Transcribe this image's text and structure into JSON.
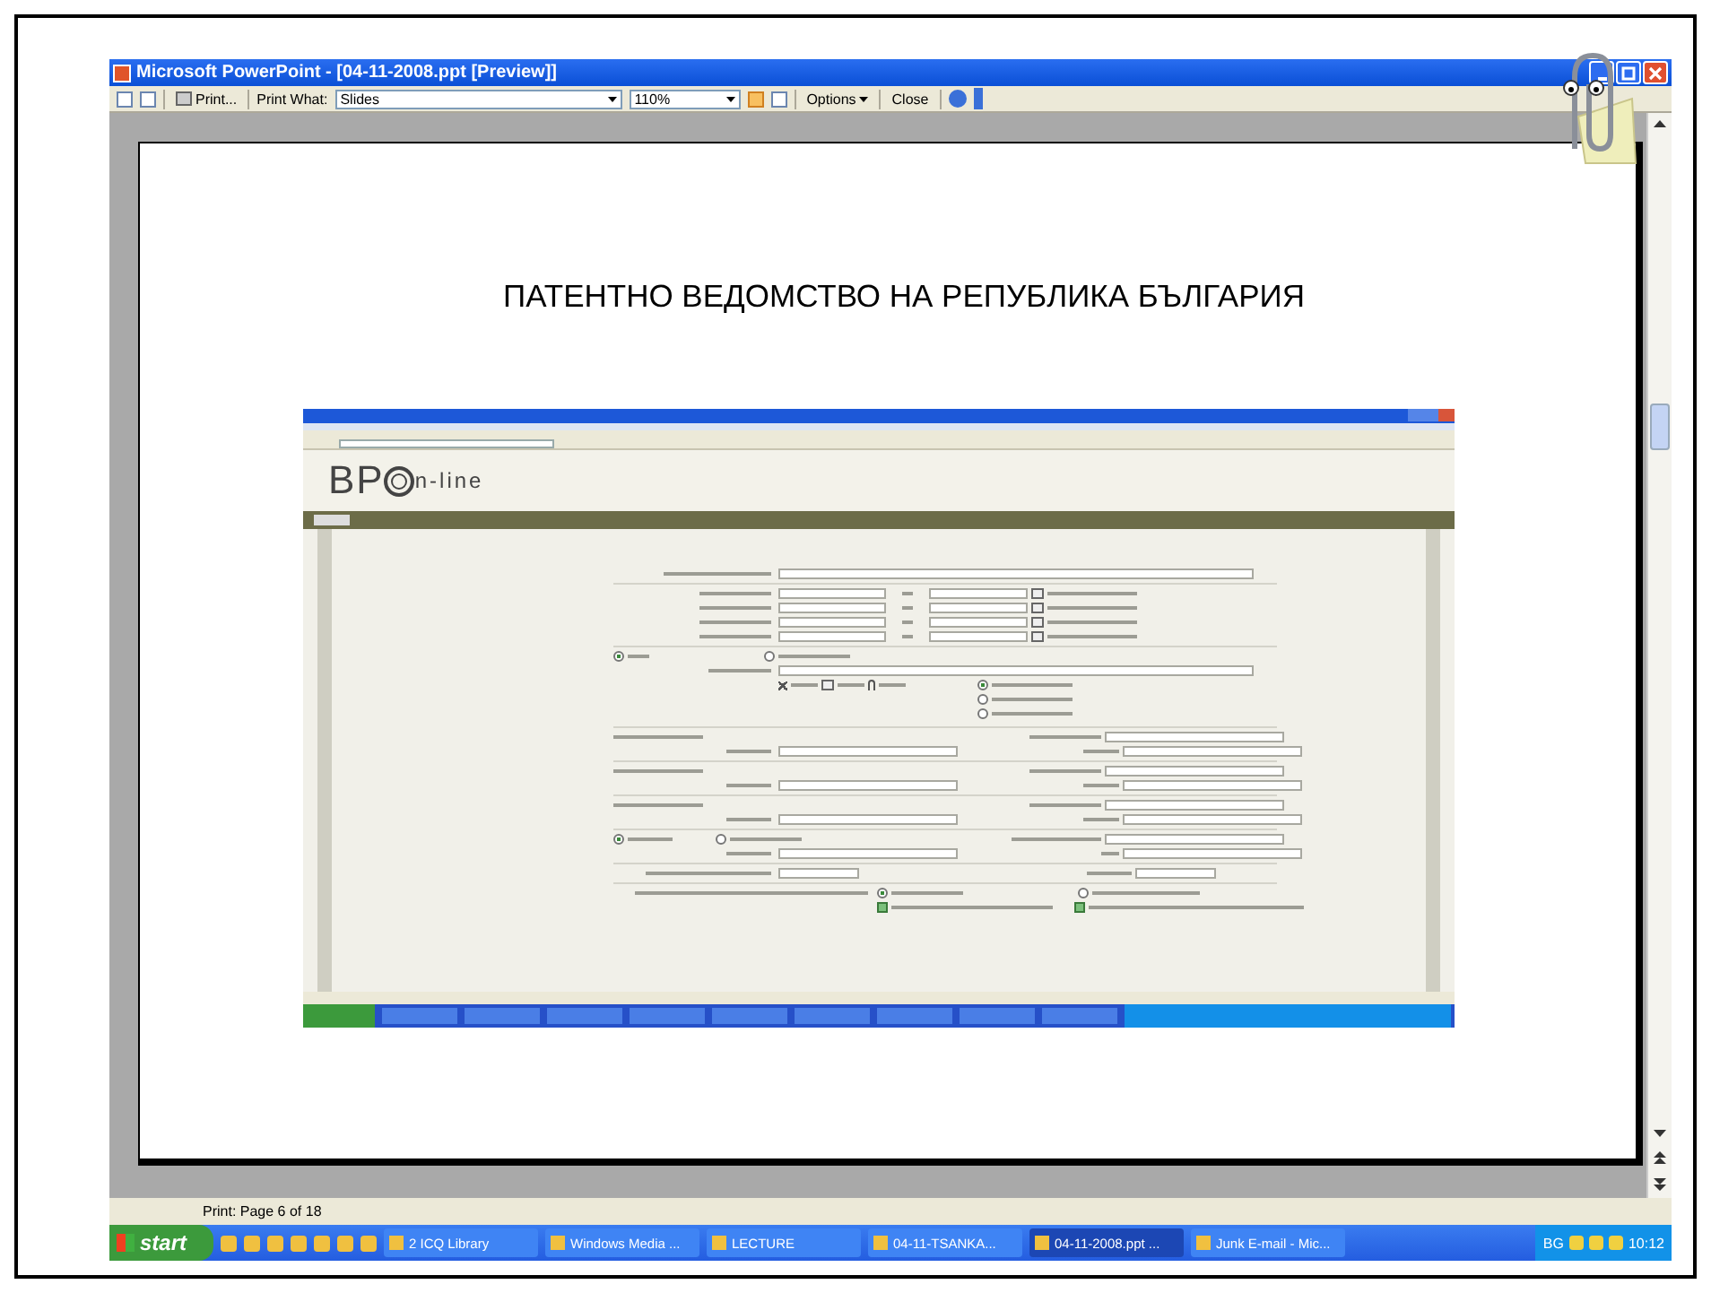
{
  "window": {
    "title": "Microsoft PowerPoint - [04-11-2008.ppt [Preview]]"
  },
  "toolbar": {
    "print": "Print...",
    "print_what_label": "Print What:",
    "print_what_value": "Slides",
    "zoom": "110%",
    "options": "Options",
    "close": "Close"
  },
  "slide": {
    "title": "ПАТЕНТНО ВЕДОМСТВО НА РЕПУБЛИКА БЪЛГАРИЯ",
    "screenshot": {
      "logo_main": "BP",
      "logo_rest": "n-line",
      "radios": [
        {
          "selected": true
        },
        {
          "selected": false
        },
        {
          "selected": true
        },
        {
          "selected": false
        },
        {
          "selected": false
        },
        {
          "selected": true
        },
        {
          "selected": false
        },
        {
          "selected": true
        },
        {
          "selected": false
        }
      ],
      "checkboxes": [
        {
          "checked": true
        },
        {
          "checked": true
        }
      ]
    }
  },
  "status_bar": "Print: Page 6 of 18",
  "taskbar": {
    "start": "start",
    "items": [
      {
        "label": "2 ICQ Library",
        "selected": false
      },
      {
        "label": "Windows Media ...",
        "selected": false
      },
      {
        "label": "LECTURE",
        "selected": false
      },
      {
        "label": "04-11-TSANKA...",
        "selected": false
      },
      {
        "label": "04-11-2008.ppt ...",
        "selected": true
      },
      {
        "label": "Junk E-mail - Mic...",
        "selected": false
      }
    ],
    "language": "BG",
    "clock": "10:12"
  }
}
